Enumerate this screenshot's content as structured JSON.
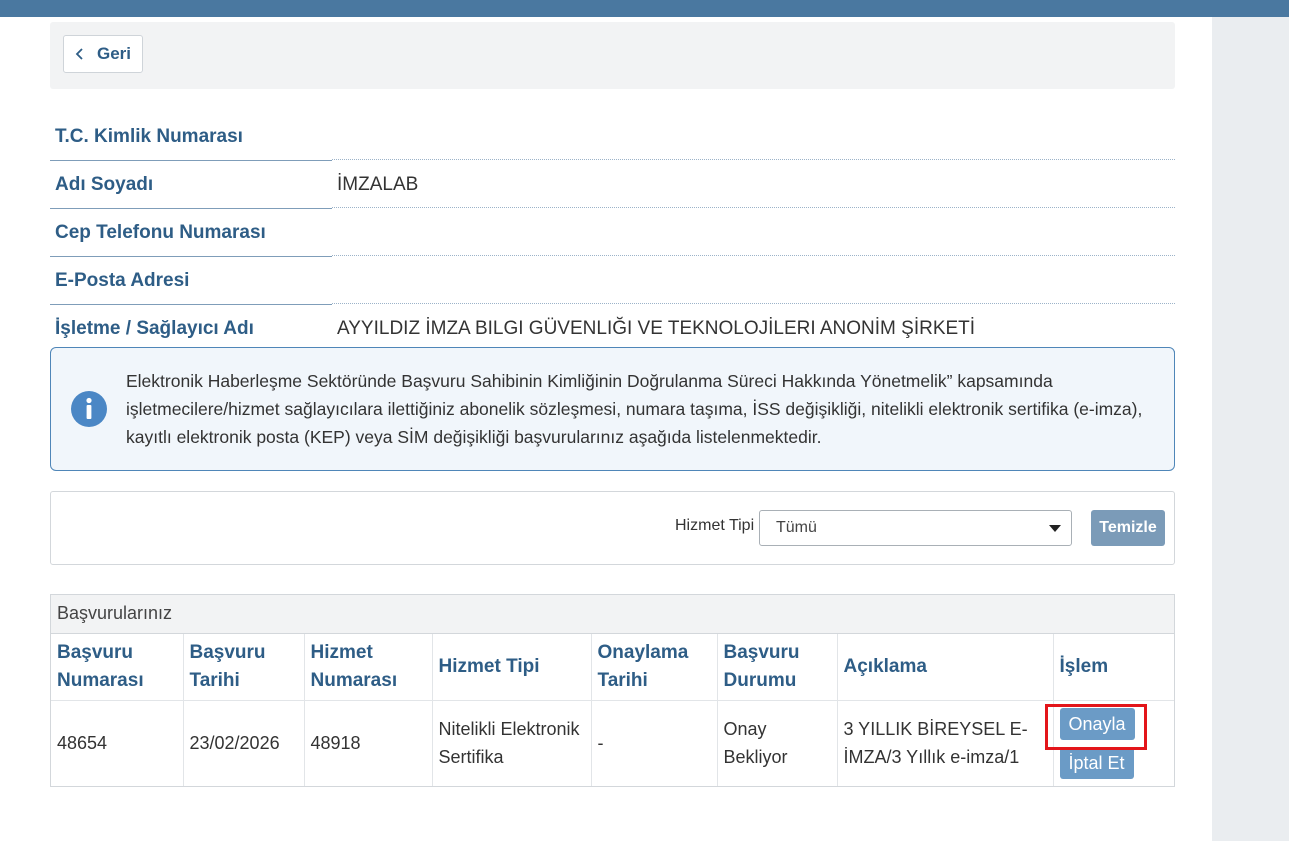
{
  "nav": {
    "back_label": "Geri"
  },
  "person": {
    "rows": [
      {
        "label": "T.C. Kimlik Numarası",
        "value": ""
      },
      {
        "label": "Adı Soyadı",
        "value": "İMZALAB"
      },
      {
        "label": "Cep Telefonu Numarası",
        "value": ""
      },
      {
        "label": "E-Posta Adresi",
        "value": ""
      },
      {
        "label": "İşletme / Sağlayıcı Adı",
        "value": "AYYILDIZ İMZA BILGI GÜVENLIĞI VE TEKNOLOJİLERI ANONİM ŞİRKETİ"
      }
    ]
  },
  "notice": {
    "icon": "info-icon",
    "text": "Elektronik Haberleşme Sektöründe Başvuru Sahibinin Kimliğinin Doğrulanma Süreci Hakkında Yönetmelik” kapsamında işletmecilere/hizmet sağlayıcılara ilettiğiniz abonelik sözleşmesi, numara taşıma, İSS değişikliği, nitelikli elektronik sertifika (e-imza), kayıtlı elektronik posta (KEP) veya SİM değişikliği başvurularınız aşağıda listelenmektedir."
  },
  "filter": {
    "label": "Hizmet Tipi",
    "selected": "Tümü",
    "clear_label": "Temizle"
  },
  "applications": {
    "title": "Başvurularınız",
    "columns": [
      "Başvuru Numarası",
      "Başvuru Tarihi",
      "Hizmet Numarası",
      "Hizmet Tipi",
      "Onaylama Tarihi",
      "Başvuru Durumu",
      "Açıklama",
      "İşlem"
    ],
    "rows": [
      {
        "number": "48654",
        "date": "23/02/2026",
        "service_number": "48918",
        "service_type": "Nitelikli Elektronik Sertifika",
        "approval_date": "-",
        "status": "Onay Bekliyor",
        "description": "3 YILLIK BİREYSEL E-İMZA/3 Yıllık e-imza/1",
        "approve_label": "Onayla",
        "cancel_label": "İptal Et"
      }
    ]
  },
  "colors": {
    "topbar": "#4a78a0",
    "label_blue": "#2e5d86",
    "button_blue": "#6b9bc6",
    "highlight_red": "#e3151a"
  }
}
